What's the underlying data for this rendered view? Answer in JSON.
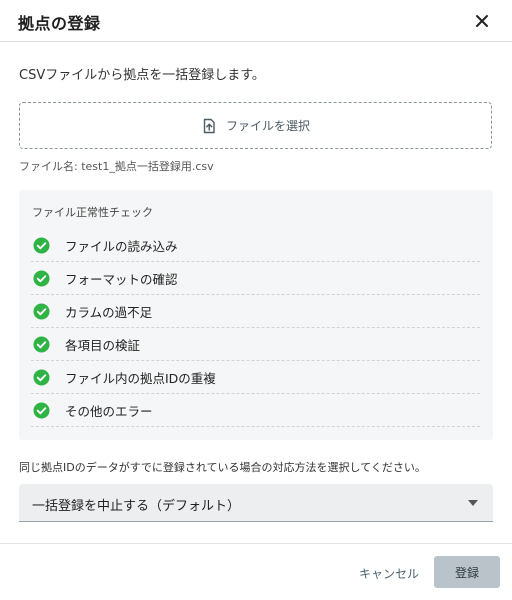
{
  "dialog": {
    "title": "拠点の登録",
    "close_icon": "close-icon"
  },
  "intro_text": "CSVファイルから拠点を一括登録します。",
  "file_select": {
    "label": "ファイルを選択",
    "icon": "upload-file-icon"
  },
  "file_name": "ファイル名: test1_拠点一括登録用.csv",
  "check": {
    "title": "ファイル正常性チェック",
    "icon": "check-circle-icon",
    "color": "#2fb344",
    "items": [
      {
        "label": "ファイルの読み込み"
      },
      {
        "label": "フォーマットの確認"
      },
      {
        "label": "カラムの過不足"
      },
      {
        "label": "各項目の検証"
      },
      {
        "label": "ファイル内の拠点IDの重複"
      },
      {
        "label": "その他のエラー"
      }
    ]
  },
  "duplicate": {
    "description": "同じ拠点IDのデータがすでに登録されている場合の対応方法を選択してください。",
    "selected": "一括登録を中止する（デフォルト）"
  },
  "footer": {
    "cancel_label": "キャンセル",
    "register_label": "登録"
  },
  "colors": {
    "success": "#2fb344",
    "register_button": "#b9c3c9",
    "select_background": "#eceef0"
  }
}
